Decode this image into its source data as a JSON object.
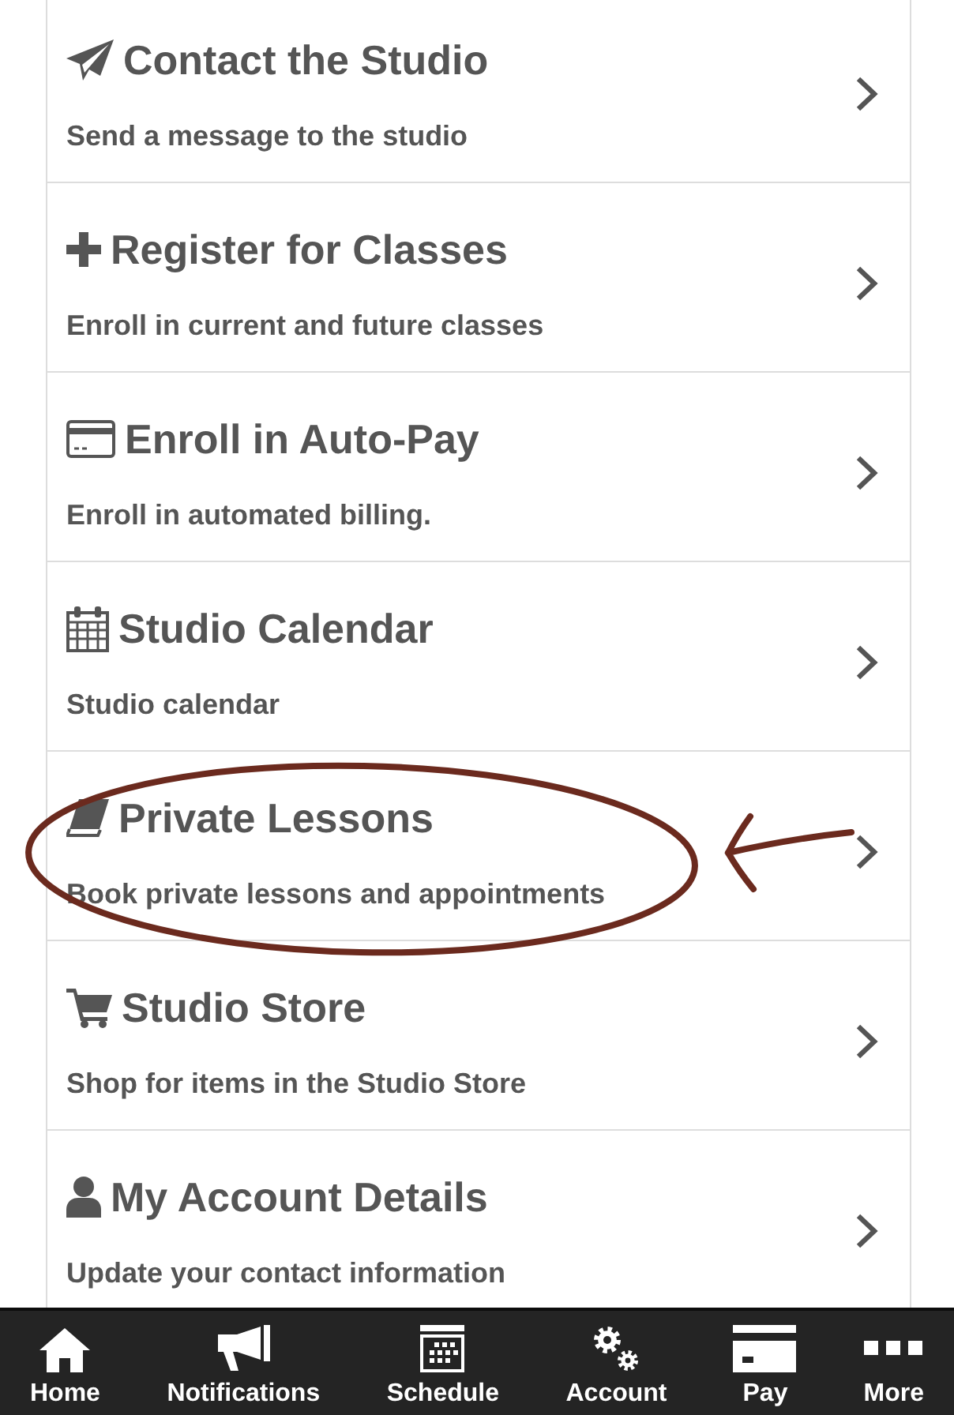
{
  "menu_items": [
    {
      "title": "Contact the Studio",
      "description": "Send a message to the studio",
      "highlighted": false
    },
    {
      "title": "Register for Classes",
      "description": "Enroll in current and future classes",
      "highlighted": false
    },
    {
      "title": "Enroll in Auto-Pay",
      "description": "Enroll in automated billing.",
      "highlighted": false
    },
    {
      "title": "Studio Calendar",
      "description": "Studio calendar",
      "highlighted": false
    },
    {
      "title": "Private Lessons",
      "description": "Book private lessons and appointments",
      "highlighted": true
    },
    {
      "title": "Studio Store",
      "description": "Shop for items in the Studio Store",
      "highlighted": false
    },
    {
      "title": "My Account Details",
      "description": "Update your contact information",
      "highlighted": false
    }
  ],
  "bottom_nav": [
    {
      "label": "Home"
    },
    {
      "label": "Notifications"
    },
    {
      "label": "Schedule"
    },
    {
      "label": "Account"
    },
    {
      "label": "Pay"
    },
    {
      "label": "More"
    }
  ]
}
